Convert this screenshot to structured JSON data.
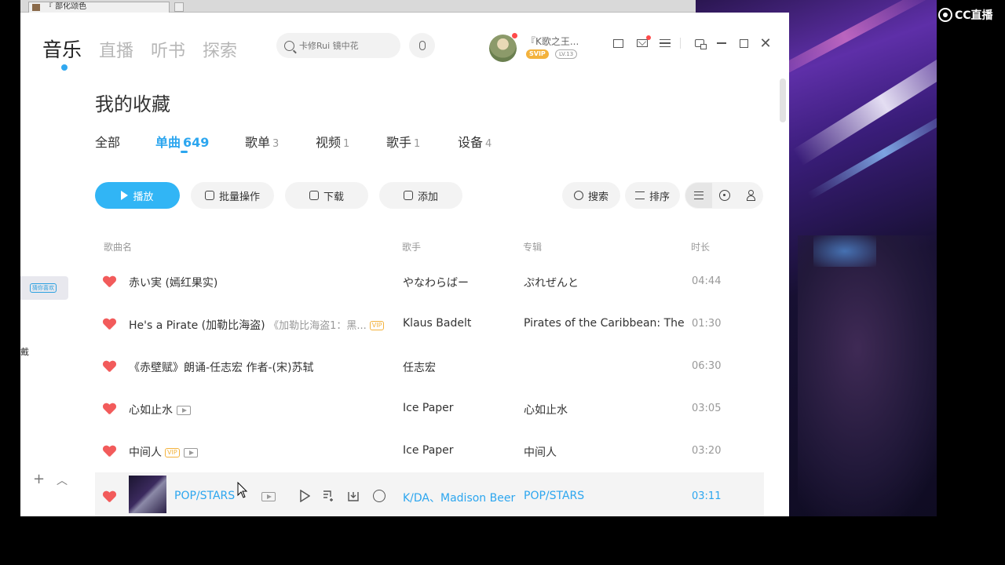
{
  "background": {
    "strip_tab_label": "『 部化颂色",
    "overlay_logo": "CC直播",
    "sidebar_chip": "猜你喜欢",
    "sidebar_fragment": "戴"
  },
  "nav": {
    "items": [
      "音乐",
      "直播",
      "听书",
      "探索"
    ],
    "active": "音乐"
  },
  "search": {
    "placeholder": "卡修Rui 镜中花"
  },
  "user": {
    "name": "『K歌之王...",
    "badge_svip": "SVIP",
    "badge_level": "LV.13"
  },
  "page": {
    "title": "我的收藏"
  },
  "tabs": [
    {
      "label": "全部",
      "count": ""
    },
    {
      "label": "单曲",
      "count": "649",
      "active": true
    },
    {
      "label": "歌单",
      "count": "3"
    },
    {
      "label": "视频",
      "count": "1"
    },
    {
      "label": "歌手",
      "count": "1"
    },
    {
      "label": "设备",
      "count": "4"
    }
  ],
  "toolbar": {
    "play": "播放",
    "batch": "批量操作",
    "download": "下载",
    "add": "添加",
    "search": "搜索",
    "sort": "排序"
  },
  "columns": {
    "song": "歌曲名",
    "artist": "歌手",
    "album": "专辑",
    "duration": "时长"
  },
  "songs": [
    {
      "title": "赤い実 (嫣红果实)",
      "sub": "",
      "vip": false,
      "mv": false,
      "artist": "やなわらばー",
      "album": "ぷれぜんと",
      "duration": "04:44"
    },
    {
      "title": "He's a Pirate (加勒比海盗)",
      "sub": "《加勒比海盗1：黑...",
      "vip": true,
      "mv": false,
      "artist": "Klaus Badelt",
      "album": "Pirates of the Caribbean: The ...",
      "duration": "01:30"
    },
    {
      "title": "《赤壁赋》朗诵-任志宏 作者-(宋)苏轼",
      "sub": "",
      "vip": false,
      "mv": false,
      "artist": "任志宏",
      "album": "",
      "duration": "06:30"
    },
    {
      "title": "心如止水",
      "sub": "",
      "vip": false,
      "mv": true,
      "artist": "Ice Paper",
      "album": "心如止水",
      "duration": "03:05"
    },
    {
      "title": "中间人",
      "sub": "",
      "vip": true,
      "mv": true,
      "artist": "Ice Paper",
      "album": "中间人",
      "duration": "03:20"
    },
    {
      "title": "POP/STARS",
      "sub": "",
      "vip": false,
      "mv": true,
      "artist": "K/DA、Madison Beer",
      "album": "POP/STARS",
      "duration": "03:11",
      "hovered": true
    }
  ],
  "colors": {
    "accent": "#2ca6ef",
    "play_button": "#31b5f5",
    "heart": "#f25b5b",
    "vip": "#f3b23c"
  }
}
